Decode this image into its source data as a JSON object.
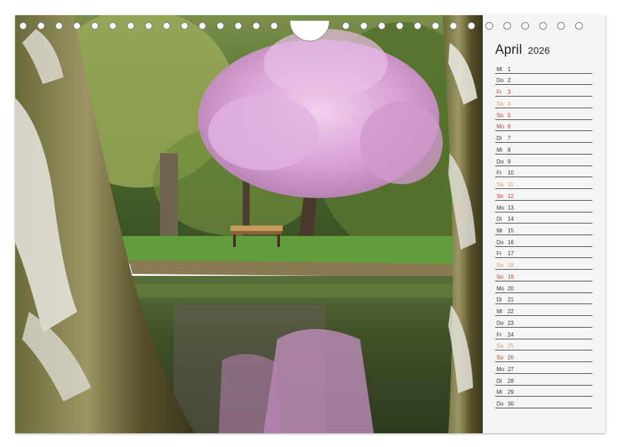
{
  "calendar": {
    "month": "April",
    "year": "2026",
    "days": [
      {
        "wd": "Mi",
        "d": "1",
        "type": "weekday"
      },
      {
        "wd": "Do",
        "d": "2",
        "type": "weekday"
      },
      {
        "wd": "Fr",
        "d": "3",
        "type": "holiday"
      },
      {
        "wd": "Sa",
        "d": "4",
        "type": "saturday"
      },
      {
        "wd": "So",
        "d": "5",
        "type": "sunday"
      },
      {
        "wd": "Mo",
        "d": "6",
        "type": "holiday"
      },
      {
        "wd": "Di",
        "d": "7",
        "type": "weekday"
      },
      {
        "wd": "Mi",
        "d": "8",
        "type": "weekday"
      },
      {
        "wd": "Do",
        "d": "9",
        "type": "weekday"
      },
      {
        "wd": "Fr",
        "d": "10",
        "type": "weekday"
      },
      {
        "wd": "Sa",
        "d": "11",
        "type": "saturday"
      },
      {
        "wd": "So",
        "d": "12",
        "type": "sunday"
      },
      {
        "wd": "Mo",
        "d": "13",
        "type": "weekday"
      },
      {
        "wd": "Di",
        "d": "14",
        "type": "weekday"
      },
      {
        "wd": "Mi",
        "d": "15",
        "type": "weekday"
      },
      {
        "wd": "Do",
        "d": "16",
        "type": "weekday"
      },
      {
        "wd": "Fr",
        "d": "17",
        "type": "weekday"
      },
      {
        "wd": "Sa",
        "d": "18",
        "type": "saturday"
      },
      {
        "wd": "So",
        "d": "19",
        "type": "sunday"
      },
      {
        "wd": "Mo",
        "d": "20",
        "type": "weekday"
      },
      {
        "wd": "Di",
        "d": "21",
        "type": "weekday"
      },
      {
        "wd": "Mi",
        "d": "22",
        "type": "weekday"
      },
      {
        "wd": "Do",
        "d": "23",
        "type": "weekday"
      },
      {
        "wd": "Fr",
        "d": "24",
        "type": "weekday"
      },
      {
        "wd": "Sa",
        "d": "25",
        "type": "saturday"
      },
      {
        "wd": "So",
        "d": "26",
        "type": "sunday"
      },
      {
        "wd": "Mo",
        "d": "27",
        "type": "weekday"
      },
      {
        "wd": "Di",
        "d": "28",
        "type": "weekday"
      },
      {
        "wd": "Mi",
        "d": "29",
        "type": "weekday"
      },
      {
        "wd": "Do",
        "d": "30",
        "type": "weekday"
      }
    ]
  },
  "colors": {
    "weekday": "#333333",
    "saturday": "#e0957a",
    "sunday": "#c0392b",
    "blossom": "#d9a3d6",
    "grass": "#5f9e3a",
    "water": "#4a5a3a"
  },
  "binding": {
    "hole_count": 32
  }
}
